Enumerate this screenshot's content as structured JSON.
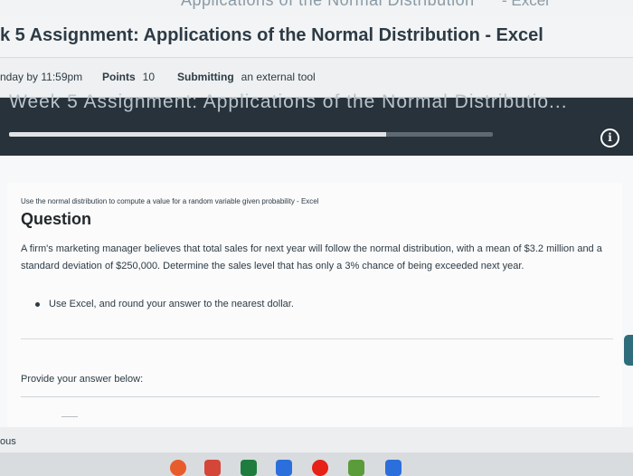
{
  "top_strip": {
    "cut_title_left": "Applications of the Normal Distribution",
    "cut_title_right": "- Excel"
  },
  "header": {
    "title": "k 5 Assignment: Applications of the Normal Distribution - Excel"
  },
  "meta": {
    "due": "nday by 11:59pm",
    "points_label": "Points",
    "points_value": "10",
    "submitting_label": "Submitting",
    "submitting_value": "an external tool"
  },
  "tool": {
    "cut_title": "Week 5 Assignment: Applications of the Normal Distributio...",
    "progress_fraction": 0.78,
    "info_glyph": "i"
  },
  "question": {
    "instruction": "Use the normal distribution to compute a value for a random variable given probability - Excel",
    "heading": "Question",
    "text": "A firm's marketing manager believes that total sales for next year will follow the normal distribution, with a mean of $3.2 million and a standard deviation of $250,000. Determine the sales level that has only a 3% chance of being exceeded next year.",
    "bullet": "Use Excel, and round your answer to the nearest dollar.",
    "answer_label": "Provide your answer below:",
    "answer_value": ""
  },
  "footer": {
    "prev_label": "ous"
  },
  "taskbar": {
    "hulu_label": "hulu",
    "icons": [
      {
        "name": "chrome-icon",
        "color": "#e85c2c"
      },
      {
        "name": "gmail-icon",
        "color": "#d44638"
      },
      {
        "name": "classroom-icon",
        "color": "#1e7c3f"
      },
      {
        "name": "docs-icon",
        "color": "#2a6fdb"
      },
      {
        "name": "youtube-icon",
        "color": "#e62117"
      },
      {
        "name": "play-icon",
        "color": "#34a853"
      },
      {
        "name": "hulu-icon",
        "color": "#5a9c3a"
      },
      {
        "name": "files-icon",
        "color": "#2a6fdb"
      }
    ]
  }
}
